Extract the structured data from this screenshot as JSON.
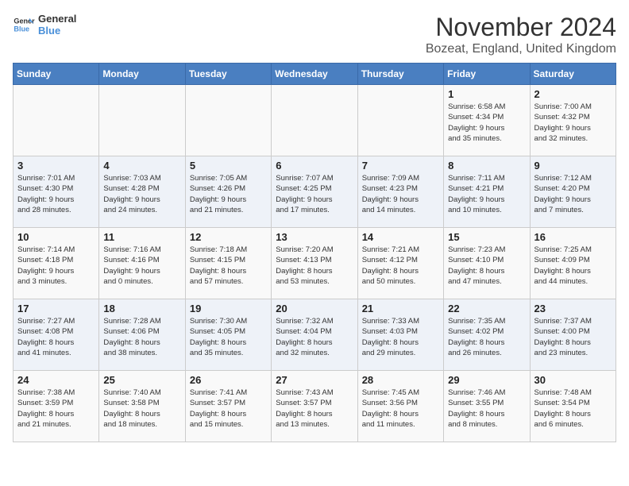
{
  "logo": {
    "line1": "General",
    "line2": "Blue"
  },
  "title": "November 2024",
  "subtitle": "Bozeat, England, United Kingdom",
  "days_of_week": [
    "Sunday",
    "Monday",
    "Tuesday",
    "Wednesday",
    "Thursday",
    "Friday",
    "Saturday"
  ],
  "weeks": [
    [
      {
        "day": "",
        "info": ""
      },
      {
        "day": "",
        "info": ""
      },
      {
        "day": "",
        "info": ""
      },
      {
        "day": "",
        "info": ""
      },
      {
        "day": "",
        "info": ""
      },
      {
        "day": "1",
        "info": "Sunrise: 6:58 AM\nSunset: 4:34 PM\nDaylight: 9 hours\nand 35 minutes."
      },
      {
        "day": "2",
        "info": "Sunrise: 7:00 AM\nSunset: 4:32 PM\nDaylight: 9 hours\nand 32 minutes."
      }
    ],
    [
      {
        "day": "3",
        "info": "Sunrise: 7:01 AM\nSunset: 4:30 PM\nDaylight: 9 hours\nand 28 minutes."
      },
      {
        "day": "4",
        "info": "Sunrise: 7:03 AM\nSunset: 4:28 PM\nDaylight: 9 hours\nand 24 minutes."
      },
      {
        "day": "5",
        "info": "Sunrise: 7:05 AM\nSunset: 4:26 PM\nDaylight: 9 hours\nand 21 minutes."
      },
      {
        "day": "6",
        "info": "Sunrise: 7:07 AM\nSunset: 4:25 PM\nDaylight: 9 hours\nand 17 minutes."
      },
      {
        "day": "7",
        "info": "Sunrise: 7:09 AM\nSunset: 4:23 PM\nDaylight: 9 hours\nand 14 minutes."
      },
      {
        "day": "8",
        "info": "Sunrise: 7:11 AM\nSunset: 4:21 PM\nDaylight: 9 hours\nand 10 minutes."
      },
      {
        "day": "9",
        "info": "Sunrise: 7:12 AM\nSunset: 4:20 PM\nDaylight: 9 hours\nand 7 minutes."
      }
    ],
    [
      {
        "day": "10",
        "info": "Sunrise: 7:14 AM\nSunset: 4:18 PM\nDaylight: 9 hours\nand 3 minutes."
      },
      {
        "day": "11",
        "info": "Sunrise: 7:16 AM\nSunset: 4:16 PM\nDaylight: 9 hours\nand 0 minutes."
      },
      {
        "day": "12",
        "info": "Sunrise: 7:18 AM\nSunset: 4:15 PM\nDaylight: 8 hours\nand 57 minutes."
      },
      {
        "day": "13",
        "info": "Sunrise: 7:20 AM\nSunset: 4:13 PM\nDaylight: 8 hours\nand 53 minutes."
      },
      {
        "day": "14",
        "info": "Sunrise: 7:21 AM\nSunset: 4:12 PM\nDaylight: 8 hours\nand 50 minutes."
      },
      {
        "day": "15",
        "info": "Sunrise: 7:23 AM\nSunset: 4:10 PM\nDaylight: 8 hours\nand 47 minutes."
      },
      {
        "day": "16",
        "info": "Sunrise: 7:25 AM\nSunset: 4:09 PM\nDaylight: 8 hours\nand 44 minutes."
      }
    ],
    [
      {
        "day": "17",
        "info": "Sunrise: 7:27 AM\nSunset: 4:08 PM\nDaylight: 8 hours\nand 41 minutes."
      },
      {
        "day": "18",
        "info": "Sunrise: 7:28 AM\nSunset: 4:06 PM\nDaylight: 8 hours\nand 38 minutes."
      },
      {
        "day": "19",
        "info": "Sunrise: 7:30 AM\nSunset: 4:05 PM\nDaylight: 8 hours\nand 35 minutes."
      },
      {
        "day": "20",
        "info": "Sunrise: 7:32 AM\nSunset: 4:04 PM\nDaylight: 8 hours\nand 32 minutes."
      },
      {
        "day": "21",
        "info": "Sunrise: 7:33 AM\nSunset: 4:03 PM\nDaylight: 8 hours\nand 29 minutes."
      },
      {
        "day": "22",
        "info": "Sunrise: 7:35 AM\nSunset: 4:02 PM\nDaylight: 8 hours\nand 26 minutes."
      },
      {
        "day": "23",
        "info": "Sunrise: 7:37 AM\nSunset: 4:00 PM\nDaylight: 8 hours\nand 23 minutes."
      }
    ],
    [
      {
        "day": "24",
        "info": "Sunrise: 7:38 AM\nSunset: 3:59 PM\nDaylight: 8 hours\nand 21 minutes."
      },
      {
        "day": "25",
        "info": "Sunrise: 7:40 AM\nSunset: 3:58 PM\nDaylight: 8 hours\nand 18 minutes."
      },
      {
        "day": "26",
        "info": "Sunrise: 7:41 AM\nSunset: 3:57 PM\nDaylight: 8 hours\nand 15 minutes."
      },
      {
        "day": "27",
        "info": "Sunrise: 7:43 AM\nSunset: 3:57 PM\nDaylight: 8 hours\nand 13 minutes."
      },
      {
        "day": "28",
        "info": "Sunrise: 7:45 AM\nSunset: 3:56 PM\nDaylight: 8 hours\nand 11 minutes."
      },
      {
        "day": "29",
        "info": "Sunrise: 7:46 AM\nSunset: 3:55 PM\nDaylight: 8 hours\nand 8 minutes."
      },
      {
        "day": "30",
        "info": "Sunrise: 7:48 AM\nSunset: 3:54 PM\nDaylight: 8 hours\nand 6 minutes."
      }
    ]
  ]
}
